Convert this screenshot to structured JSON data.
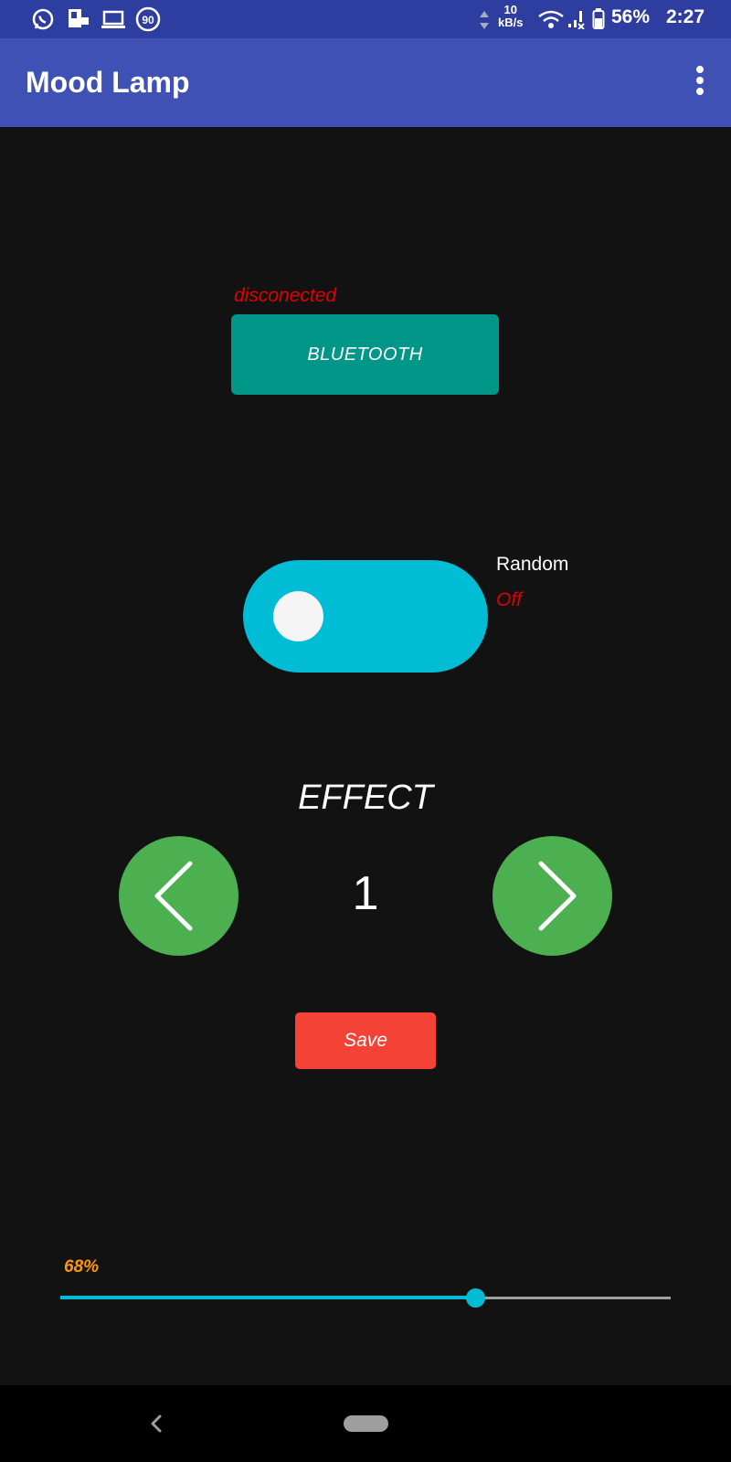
{
  "status_bar": {
    "battery_percent": "56%",
    "time": "2:27",
    "net_speed_value": "10",
    "net_speed_unit": "kB/s",
    "badge_number": "90",
    "icons": [
      "whatsapp-icon",
      "sim-card-icon",
      "laptop-icon",
      "badge-icon",
      "data-arrows-icon",
      "wifi-icon",
      "signal-icon",
      "battery-icon"
    ]
  },
  "app_bar": {
    "title": "Mood Lamp",
    "menu_icon": "more-vert-icon"
  },
  "bluetooth": {
    "status": "disconected",
    "button_label": "BLUETOOTH",
    "status_color": "#e00000",
    "button_color": "#009688"
  },
  "random": {
    "label": "Random",
    "state": "Off",
    "toggle_color": "#00bcd4"
  },
  "effect": {
    "title": "EFFECT",
    "value": "1",
    "prev_icon": "chevron-left-icon",
    "next_icon": "chevron-right-icon",
    "button_color": "#4caf50"
  },
  "save": {
    "label": "Save",
    "color": "#f44336"
  },
  "brightness": {
    "label": "68%",
    "value": 0.68,
    "label_color": "#ff9800",
    "accent_color": "#00bcd4"
  },
  "nav_bar": {
    "back_icon": "back-icon",
    "home_icon": "home-pill-icon"
  }
}
